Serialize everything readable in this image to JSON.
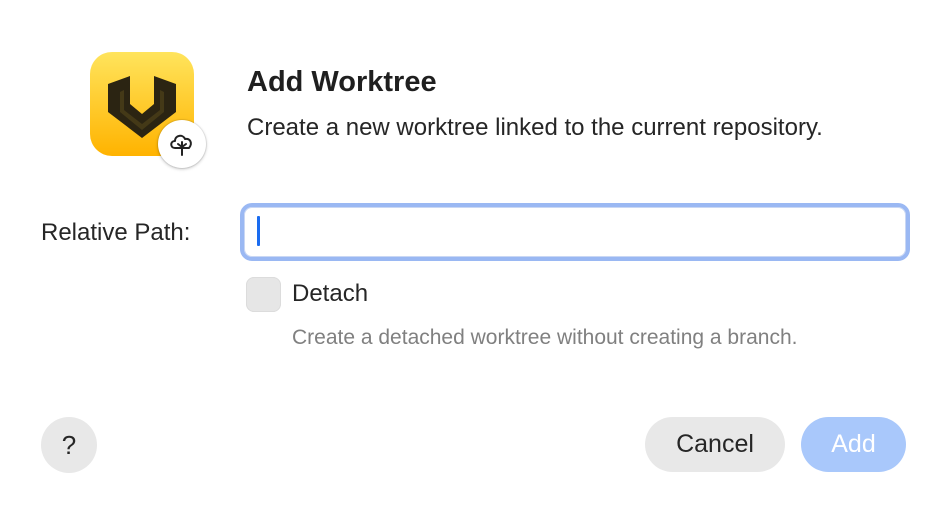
{
  "dialog": {
    "title": "Add Worktree",
    "subtitle": "Create a new worktree linked to the current repository.",
    "app_icon": "fork-app-icon",
    "badge_icon": "tree-cloud-icon"
  },
  "form": {
    "relative_path": {
      "label": "Relative Path:",
      "value": "",
      "placeholder": ""
    },
    "detach": {
      "label": "Detach",
      "checked": false,
      "hint": "Create a detached worktree without creating a branch."
    }
  },
  "buttons": {
    "help_label": "?",
    "cancel_label": "Cancel",
    "add_label": "Add",
    "add_enabled": false
  },
  "colors": {
    "focus_ring": "#9ab8f3",
    "caret": "#1a6cf0",
    "add_disabled_bg": "#a9c8fb",
    "icon_yellow_top": "#ffe45c",
    "icon_yellow_bottom": "#ffb300",
    "icon_glyph": "#2b2412"
  }
}
